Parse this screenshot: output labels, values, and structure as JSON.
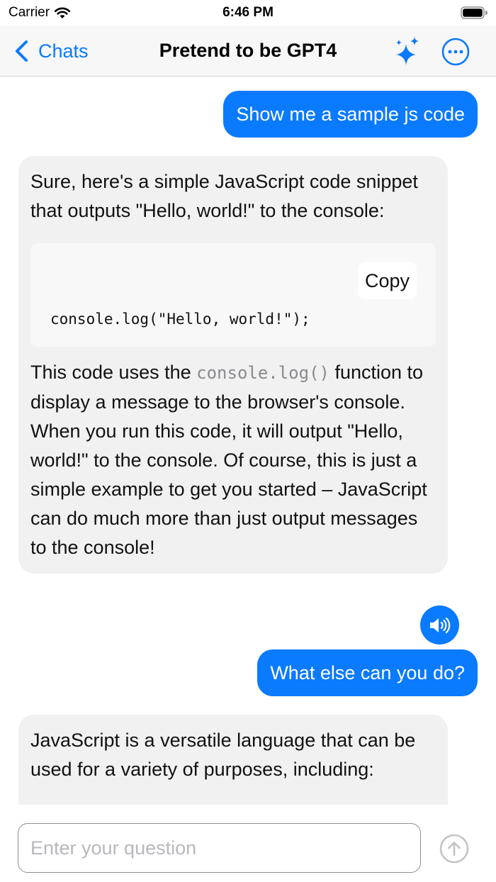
{
  "status_bar": {
    "carrier": "Carrier",
    "time": "6:46 PM"
  },
  "nav": {
    "back_label": "Chats",
    "title": "Pretend to be GPT4",
    "icons": {
      "back": "chevron-left-icon",
      "sparkle": "sparkles-icon",
      "more": "ellipsis-circle-icon"
    }
  },
  "messages": [
    {
      "role": "user",
      "text": "Show me a sample js code"
    },
    {
      "role": "assistant",
      "intro": "Sure, here's a simple JavaScript code snippet that outputs \"Hello, world!\" to the console:",
      "code": {
        "copy_label": "Copy",
        "line": "console.log(\"Hello, world!\");"
      },
      "body_before_code": "This code uses the ",
      "inline_code": "console.log()",
      "body_after_code": " function to display a message to the browser's console. When you run this code, it will output \"Hello, world!\" to the console. Of course, this is just a simple example to get you started – JavaScript can do much more than just output messages to the console!",
      "speaker_icon": "speaker-wave-icon"
    },
    {
      "role": "user",
      "text": "What else can you do?"
    },
    {
      "role": "assistant",
      "intro": "JavaScript is a versatile language that can be used for a variety of purposes, including:"
    }
  ],
  "input": {
    "placeholder": "Enter your question",
    "value": "",
    "send_icon": "arrow-up-circle-icon"
  },
  "colors": {
    "accent": "#0a7aff",
    "bot_bubble": "#f1f1f2",
    "nav_background": "#f7f7f7"
  }
}
